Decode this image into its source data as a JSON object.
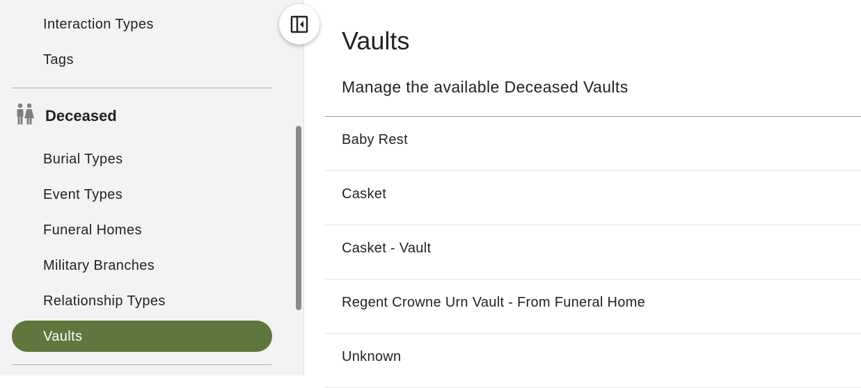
{
  "sidebar": {
    "top_items": [
      {
        "label": "Interaction Types"
      },
      {
        "label": "Tags"
      }
    ],
    "section": {
      "title": "Deceased",
      "icon": "people-icon",
      "items": [
        {
          "label": "Burial Types"
        },
        {
          "label": "Event Types"
        },
        {
          "label": "Funeral Homes"
        },
        {
          "label": "Military Branches"
        },
        {
          "label": "Relationship Types"
        }
      ],
      "active_item": {
        "label": "Vaults"
      }
    },
    "collapse_icon": "collapse-sidebar-icon"
  },
  "main": {
    "title": "Vaults",
    "subtitle": "Manage the available Deceased Vaults",
    "vaults": [
      {
        "label": "Baby Rest"
      },
      {
        "label": "Casket"
      },
      {
        "label": "Casket - Vault"
      },
      {
        "label": "Regent Crowne Urn Vault - From Funeral Home"
      },
      {
        "label": "Unknown"
      }
    ]
  },
  "colors": {
    "accent": "#5f773d",
    "sidebar_bg": "#f3f3f3",
    "icon_gray": "#7f7f7f"
  }
}
